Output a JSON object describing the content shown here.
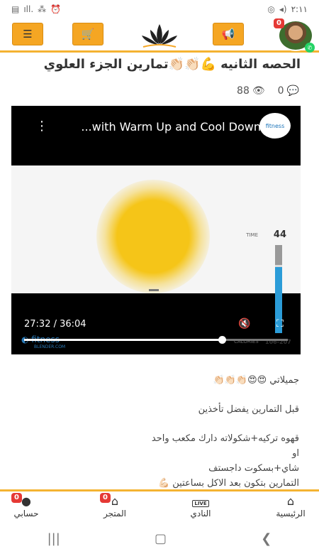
{
  "status_bar": {
    "time": "٢:١١",
    "left_icons": [
      "gallery-icon",
      "signal-icon",
      "wifi-icon",
      "alarm-icon"
    ],
    "right_icons": [
      "whatsapp-icon",
      "volume-icon"
    ]
  },
  "header": {
    "menu_icon": "menu-icon",
    "cart_icon": "cart-icon",
    "notice_icon": "megaphone-icon",
    "avatar_badge": "0",
    "accent": "#f5a623"
  },
  "post": {
    "title": "الحصه الثانيه 💪👏🏻👏🏻تمارين الجزء العلوي",
    "views": "88",
    "comments": "0"
  },
  "video": {
    "title": "...with Warm Up and Cool Down",
    "channel": "fitness",
    "time_label": "TIME",
    "time_value": "44",
    "brand": "fitness",
    "brand_sub": "BLENDER.COM",
    "calories_label": "CALORIES",
    "calories_value": "106-207",
    "current_time": "27:32 / 36:04",
    "progress": 0.75,
    "meter_level": 0.75
  },
  "body": {
    "lines": [
      "جميلاتي 😍😍👏🏻👏🏻👏🏻",
      "",
      "قبل التمارين يفضل تأخذين",
      "",
      "قهوه تركيه+شكولاته دارك مكعب واحد",
      "او",
      "شاي+بسكوت داجستف",
      "التمارين بتكون بعد الاكل بساعتين 💪🏻"
    ]
  },
  "bottom_nav": {
    "home": "الرئيسية",
    "club": "النادي",
    "store": "المتجر",
    "account": "حسابي",
    "store_badge": "0",
    "account_badge": "0",
    "live": "LIVE"
  }
}
